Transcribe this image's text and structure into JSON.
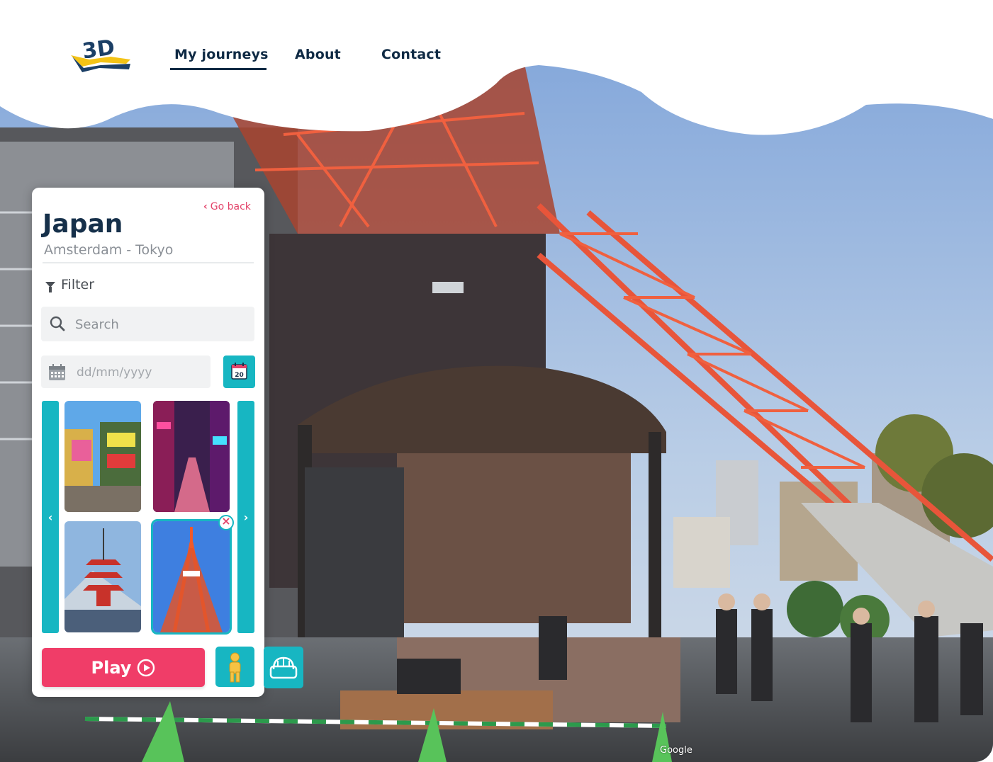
{
  "header": {
    "logo_text": "3D",
    "nav": [
      {
        "label": "My journeys",
        "active": true
      },
      {
        "label": "About",
        "active": false
      },
      {
        "label": "Contact",
        "active": false
      }
    ]
  },
  "panel": {
    "go_back_label": "Go back",
    "title": "Japan",
    "subtitle": "Amsterdam - Tokyo",
    "filter_label": "Filter",
    "search_placeholder": "Search",
    "date_placeholder": "dd/mm/yyyy",
    "calendar_button_day": "20",
    "thumbnails": [
      {
        "name": "akihabara-street",
        "selected": false
      },
      {
        "name": "neon-night-street",
        "selected": false
      },
      {
        "name": "chureito-pagoda",
        "selected": false
      },
      {
        "name": "tokyo-tower",
        "selected": true
      }
    ],
    "play_label": "Play"
  },
  "map_attribution": "Google",
  "colors": {
    "accent_teal": "#17b6c2",
    "accent_pink": "#f03d68",
    "navy": "#16304a",
    "logo_yellow": "#f3c316"
  },
  "icons": [
    "chevron-left-icon",
    "filter-icon",
    "search-icon",
    "calendar-icon",
    "calendar-20-icon",
    "chevron-left-icon",
    "chevron-right-icon",
    "remove-icon",
    "play-circle-icon",
    "pegman-icon",
    "vr-headset-icon"
  ]
}
